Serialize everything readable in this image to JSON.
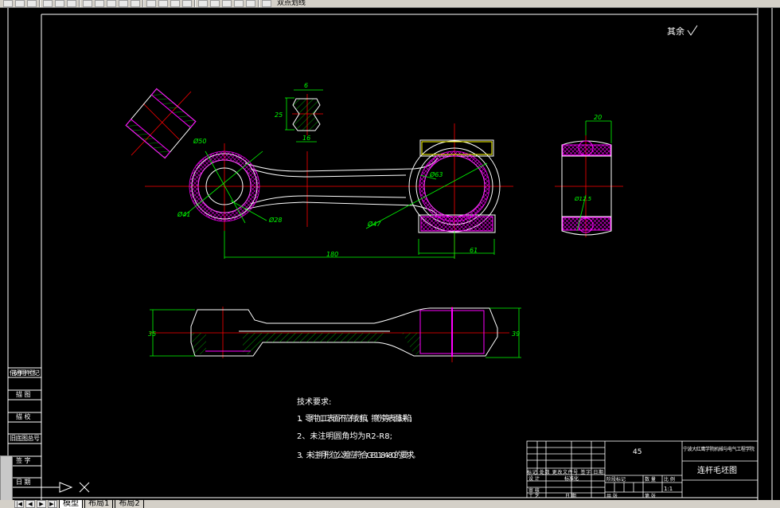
{
  "toolbar": {
    "layer_name": "双点划线",
    "icons": [
      "new-icon",
      "open-icon",
      "save-icon",
      "print-icon",
      "preview-icon",
      "publish-icon",
      "cut-icon",
      "copy-icon",
      "paste-icon",
      "match-icon",
      "undo-icon",
      "pan-icon",
      "zoom-realtime-icon",
      "zoom-window-icon",
      "zoom-previous-icon",
      "properties-icon",
      "design-center-icon",
      "tool-palette-icon",
      "calc-icon",
      "help-icon",
      "layer-icon"
    ]
  },
  "tabs": {
    "items": [
      {
        "label": "模型",
        "active": true
      },
      {
        "label": "布局1",
        "active": false
      },
      {
        "label": "布局2",
        "active": false
      }
    ]
  },
  "drawing": {
    "roughness_note": "其余",
    "dimensions": {
      "rib_width": "6",
      "rib_height": "25",
      "rib_base": "16",
      "small_end_outer": "Ø50",
      "small_end_mid": "Ø41",
      "small_end_bore": "Ø28",
      "big_end_outer": "Ø63",
      "big_end_bore": "Ø47",
      "center_distance": "180",
      "big_end_half": "61",
      "small_end_thickness": "35",
      "big_end_thickness": "39",
      "side_width": "20",
      "bolt_dia": "Ø12.5"
    },
    "tech_requirements": {
      "title": "技术要求:",
      "items": [
        "1、零件加工表面不应有划痕、擦伤等表面缺陷;",
        "2、未注明圆角均为R2-R8;",
        "3、未注明形位公差应符合GB1184-80的要求。"
      ]
    },
    "side_strip": [
      "借(通)用件登记",
      "描 图",
      "描 校",
      "旧底图总号",
      "签 字",
      "日 期"
    ],
    "title_block": {
      "material": "45",
      "school": "宁波大红鹰学院机械与电气工程学院",
      "part_name": "连杆毛坯图",
      "scale": "1:1",
      "headers_row": [
        "标记",
        "处数",
        "更改文件号",
        "签字",
        "日期"
      ],
      "designer": "设 计",
      "standardize": "标准化",
      "review": "审 核",
      "process": "工 艺",
      "date": "日 期",
      "stage_marks": "阶段标记",
      "weight": "数 量",
      "scale_label": "比 例",
      "sheets_total": "共    张",
      "sheet_no": "第    张"
    }
  },
  "colors": {
    "background": "#000000",
    "outline": "#ffffff",
    "center_line": "#ff0000",
    "dimension": "#00ff00",
    "hatch_bearing": "#ff00ff",
    "yellow": "#ffff00"
  }
}
